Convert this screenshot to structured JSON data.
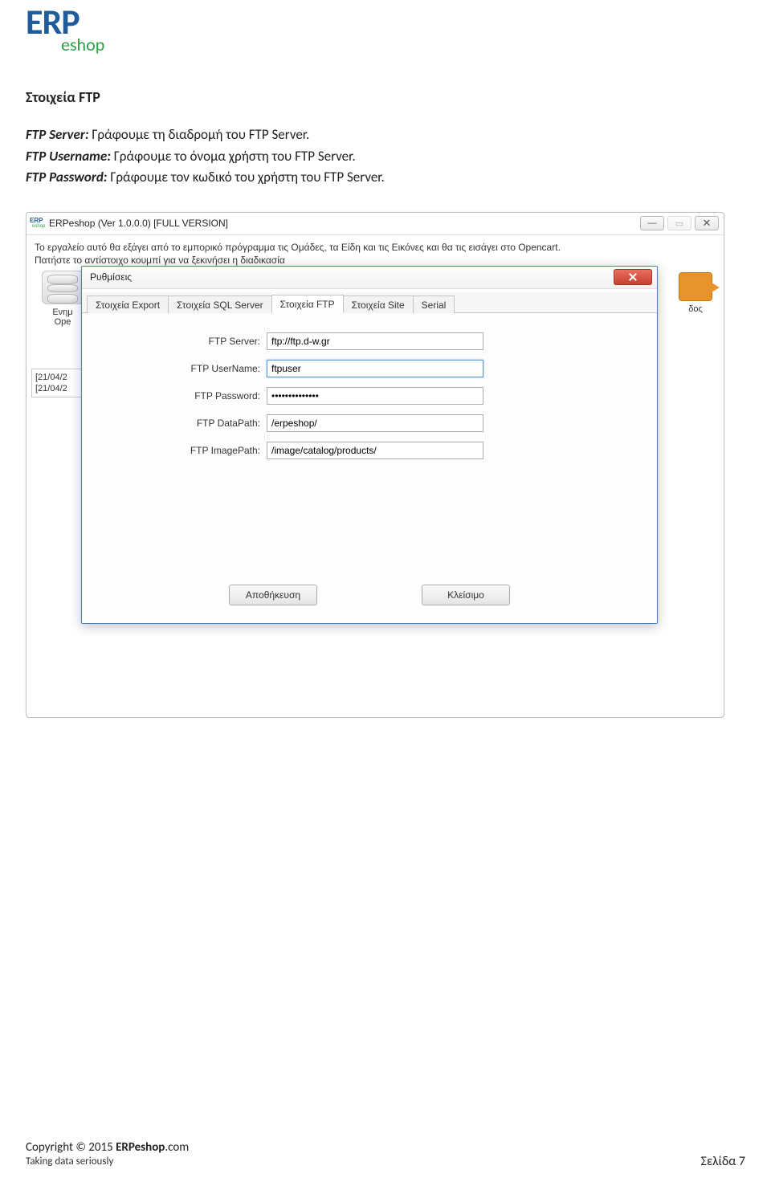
{
  "logo": {
    "line1": "ERP",
    "line2": "eshop"
  },
  "section_title": "Στοιχεία FTP",
  "description": [
    {
      "bold": "FTP Server:",
      "rest": " Γράφουμε τη διαδρομή του FTP Server."
    },
    {
      "bold": "FTP Username:",
      "rest": " Γράφουμε το όνομα χρήστη του FTP Server."
    },
    {
      "bold": "FTP Password:",
      "rest": " Γράφουμε τον κωδικό του χρήστη του FTP Server."
    }
  ],
  "app": {
    "title": "ERPeshop (Ver 1.0.0.0) [FULL VERSION]",
    "intro_line1": "Το εργαλείο αυτό θα εξάγει από το εμπορικό πρόγραμμα τις Ομάδες, τα Είδη και τις Εικόνες και θα τις εισάγει στο Opencart.",
    "intro_line2": "Πατήστε το αντίστοιχο κουμπί για να ξεκινήσει η διαδικασία",
    "left_label_1": "Ενημ",
    "left_label_2": "Ope",
    "right_label": "δος",
    "log_1": "[21/04/2",
    "log_2": "[21/04/2"
  },
  "dialog": {
    "title": "Ρυθμίσεις",
    "tabs": [
      "Στοιχεία Export",
      "Στοιχεία SQL Server",
      "Στοιχεία FTP",
      "Στοιχεία Site",
      "Serial"
    ],
    "active_tab_index": 2,
    "fields": {
      "server": {
        "label": "FTP Server:",
        "value": "ftp://ftp.d-w.gr"
      },
      "username": {
        "label": "FTP UserName:",
        "value": "ftpuser"
      },
      "password": {
        "label": "FTP Password:",
        "value": "••••••••••••••"
      },
      "datapath": {
        "label": "FTP DataPath:",
        "value": "/erpeshop/"
      },
      "imgpath": {
        "label": "FTP ImagePath:",
        "value": "/image/catalog/products/"
      }
    },
    "buttons": {
      "save": "Αποθήκευση",
      "close": "Κλείσιμο"
    }
  },
  "footer": {
    "copyright_prefix": "Copyright © 2015 ",
    "brand": "ERPeshop",
    "brand_suffix": ".com",
    "tagline": "Taking data seriously",
    "page": "Σελίδα 7"
  }
}
